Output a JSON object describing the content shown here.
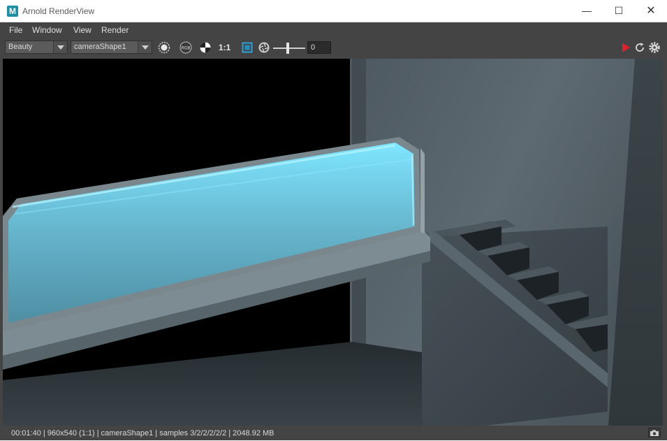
{
  "window": {
    "title": "Arnold RenderView",
    "app_icon_letter": "M",
    "min_glyph": "—",
    "max_glyph": "☐",
    "close_glyph": "✕"
  },
  "menu": [
    "File",
    "Window",
    "View",
    "Render"
  ],
  "toolbar": {
    "aov": "Beauty",
    "camera": "cameraShape1",
    "rgb_label": "RGB",
    "ratio": "1:1",
    "exposure_value": "0"
  },
  "status": "00:01:40 | 960x540 (1:1) | cameraShape1  | samples 3/2/2/2/2/2 | 2048.92 MB",
  "colors": {
    "render_button": "#e0202a",
    "panel_bg": "#444444",
    "glass_glow": "#7fe6ff"
  }
}
